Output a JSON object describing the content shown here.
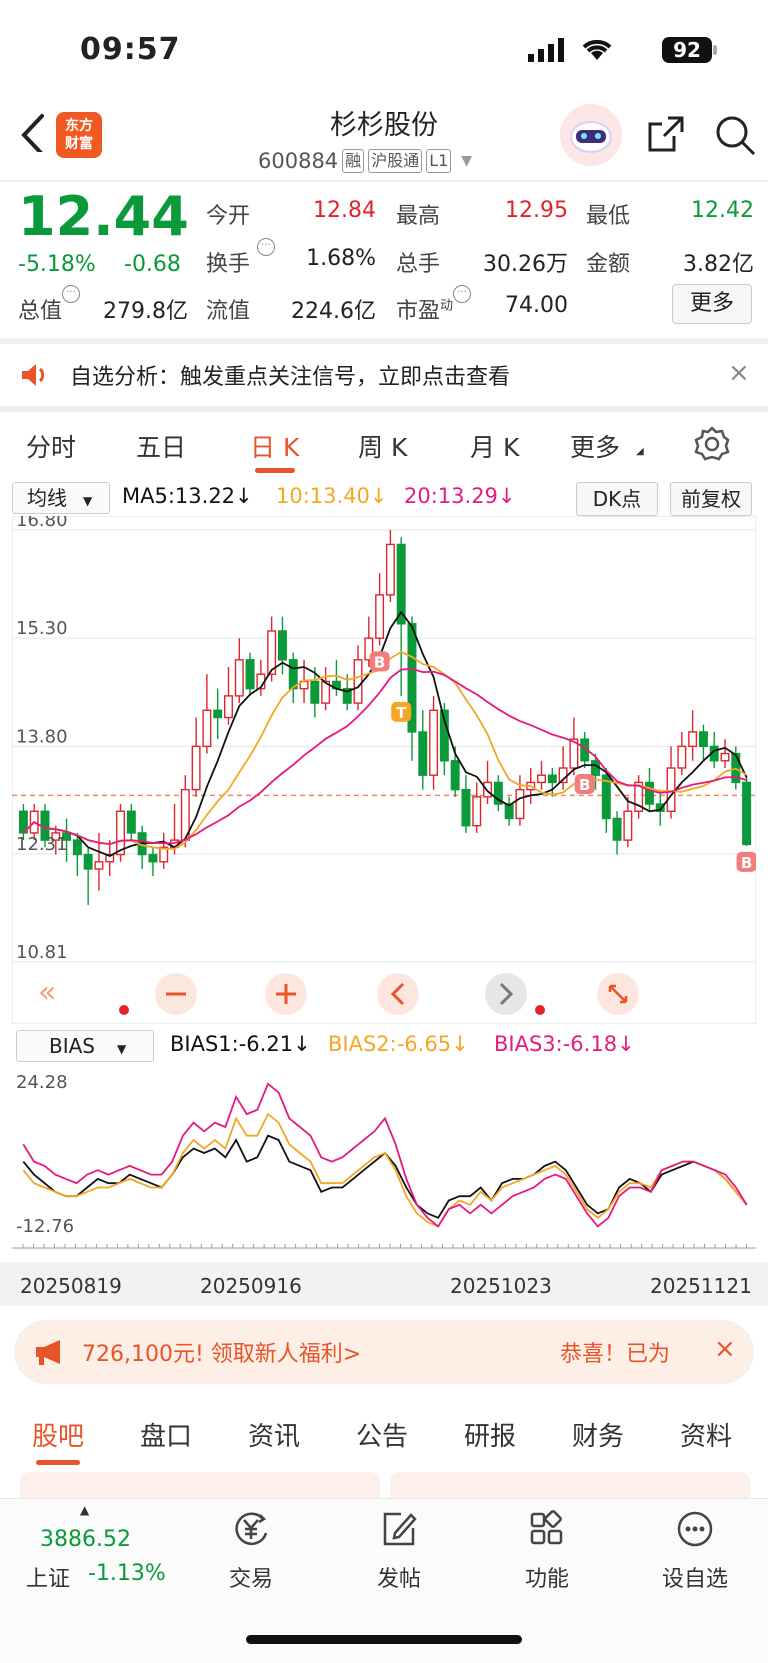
{
  "status_bar": {
    "time": "09:57",
    "battery": "92"
  },
  "header": {
    "logo_text_1": "东方",
    "logo_text_2": "财富",
    "stock_name": "杉杉股份",
    "stock_code": "600884",
    "tags": [
      "融",
      "沪股通",
      "L1"
    ]
  },
  "quote": {
    "price": "12.44",
    "change_pct": "-5.18%",
    "change": "-0.68",
    "open_label": "今开",
    "open": "12.84",
    "high_label": "最高",
    "high": "12.95",
    "low_label": "最低",
    "low": "12.42",
    "turnover_label": "换手",
    "turnover": "1.68%",
    "volume_label": "总手",
    "volume": "30.26万",
    "amount_label": "金额",
    "amount": "3.82亿",
    "mktcap_label": "总值",
    "mktcap": "279.8亿",
    "float_label": "流值",
    "float_cap": "224.6亿",
    "pe_label": "市盈",
    "pe_sup": "动",
    "pe": "74.00",
    "more_button": "更多"
  },
  "notice": {
    "text": "自选分析：触发重点关注信号，立即点击查看",
    "close": "×"
  },
  "period_tabs": [
    {
      "label": "分时"
    },
    {
      "label": "五日"
    },
    {
      "label": "日 K"
    },
    {
      "label": "周 K"
    },
    {
      "label": "月 K"
    },
    {
      "label": "更多"
    }
  ],
  "ma_row": {
    "select": "均线",
    "ma5": "MA5:13.22",
    "ma10": "10:13.40",
    "ma20": "20:13.29",
    "dk_button": "DK点",
    "fq_button": "前复权"
  },
  "colors": {
    "up": "#e0242c",
    "down": "#0a9a3a",
    "ma5": "#111111",
    "ma10": "#f5a623",
    "ma20": "#e5197f",
    "accent": "#e8542a"
  },
  "chart_data": [
    {
      "type": "candlestick",
      "title": "",
      "y_ticks": [
        "16.80",
        "15.30",
        "13.80",
        "12.31",
        "10.81"
      ],
      "ylim": [
        10.81,
        16.8
      ],
      "reference_price": 13.12,
      "markers": [
        "B",
        "T",
        "B",
        "B"
      ],
      "candles": [
        [
          12.9,
          12.6,
          13.0,
          12.5
        ],
        [
          12.6,
          12.9,
          13.0,
          12.5
        ],
        [
          12.9,
          12.5,
          13.0,
          12.4
        ],
        [
          12.5,
          12.6,
          12.7,
          12.3
        ],
        [
          12.6,
          12.5,
          12.8,
          12.2
        ],
        [
          12.5,
          12.3,
          12.6,
          12.0
        ],
        [
          12.3,
          12.1,
          12.4,
          11.6
        ],
        [
          12.1,
          12.2,
          12.6,
          11.8
        ],
        [
          12.2,
          12.3,
          12.5,
          12.0
        ],
        [
          12.3,
          12.9,
          13.0,
          12.2
        ],
        [
          12.9,
          12.6,
          13.0,
          12.5
        ],
        [
          12.6,
          12.3,
          12.7,
          12.1
        ],
        [
          12.3,
          12.2,
          12.4,
          12.0
        ],
        [
          12.2,
          12.4,
          12.6,
          12.1
        ],
        [
          12.4,
          12.5,
          13.0,
          12.3
        ],
        [
          12.5,
          13.2,
          13.4,
          12.4
        ],
        [
          13.2,
          13.8,
          14.2,
          13.1
        ],
        [
          13.8,
          14.3,
          14.8,
          13.7
        ],
        [
          14.3,
          14.2,
          14.6,
          13.9
        ],
        [
          14.2,
          14.5,
          14.9,
          14.1
        ],
        [
          14.5,
          15.0,
          15.3,
          14.4
        ],
        [
          15.0,
          14.6,
          15.1,
          14.5
        ],
        [
          14.6,
          14.8,
          15.0,
          14.5
        ],
        [
          14.8,
          15.4,
          15.6,
          14.7
        ],
        [
          15.4,
          15.0,
          15.6,
          14.8
        ],
        [
          15.0,
          14.6,
          15.1,
          14.4
        ],
        [
          14.6,
          14.7,
          15.0,
          14.4
        ],
        [
          14.7,
          14.4,
          14.9,
          14.2
        ],
        [
          14.4,
          14.7,
          14.9,
          14.3
        ],
        [
          14.7,
          14.6,
          15.0,
          14.5
        ],
        [
          14.6,
          14.4,
          14.8,
          14.3
        ],
        [
          14.4,
          15.0,
          15.2,
          14.3
        ],
        [
          15.0,
          15.3,
          15.6,
          14.9
        ],
        [
          15.3,
          15.9,
          16.2,
          15.2
        ],
        [
          15.9,
          16.6,
          16.8,
          15.8
        ],
        [
          16.6,
          15.5,
          16.7,
          14.5
        ],
        [
          15.5,
          14.0,
          15.6,
          13.6
        ],
        [
          14.0,
          13.4,
          14.3,
          13.2
        ],
        [
          13.4,
          14.3,
          14.5,
          13.2
        ],
        [
          14.3,
          13.6,
          14.4,
          13.4
        ],
        [
          13.6,
          13.2,
          13.8,
          13.1
        ],
        [
          13.2,
          12.7,
          13.4,
          12.6
        ],
        [
          12.7,
          13.1,
          13.3,
          12.6
        ],
        [
          13.1,
          13.3,
          13.6,
          13.0
        ],
        [
          13.3,
          13.0,
          13.4,
          12.9
        ],
        [
          13.0,
          12.8,
          13.1,
          12.7
        ],
        [
          12.8,
          13.2,
          13.4,
          12.7
        ],
        [
          13.2,
          13.3,
          13.5,
          13.0
        ],
        [
          13.3,
          13.4,
          13.6,
          13.2
        ],
        [
          13.4,
          13.3,
          13.5,
          13.1
        ],
        [
          13.3,
          13.5,
          13.8,
          13.2
        ],
        [
          13.5,
          13.9,
          14.2,
          13.4
        ],
        [
          13.9,
          13.6,
          14.0,
          13.5
        ],
        [
          13.6,
          13.4,
          13.7,
          13.2
        ],
        [
          13.4,
          12.8,
          13.5,
          12.6
        ],
        [
          12.8,
          12.5,
          12.9,
          12.3
        ],
        [
          12.5,
          12.9,
          13.1,
          12.4
        ],
        [
          12.9,
          13.3,
          13.4,
          12.8
        ],
        [
          13.3,
          13.0,
          13.5,
          12.9
        ],
        [
          13.0,
          12.9,
          13.2,
          12.7
        ],
        [
          12.9,
          13.5,
          13.8,
          12.8
        ],
        [
          13.5,
          13.8,
          14.0,
          13.4
        ],
        [
          13.8,
          14.0,
          14.3,
          13.6
        ],
        [
          14.0,
          13.8,
          14.1,
          13.6
        ],
        [
          13.8,
          13.6,
          14.0,
          13.5
        ],
        [
          13.6,
          13.7,
          13.9,
          13.5
        ],
        [
          13.7,
          13.3,
          13.8,
          13.2
        ],
        [
          13.3,
          12.44,
          13.4,
          12.42
        ]
      ]
    },
    {
      "type": "line",
      "title": "",
      "select": "BIAS",
      "labels": {
        "bias1": "BIAS1:-6.21",
        "bias2": "BIAS2:-6.65",
        "bias3": "BIAS3:-6.18"
      },
      "y_ticks": [
        "24.28",
        "-12.76"
      ],
      "ylim": [
        -12.76,
        24.28
      ],
      "x_ticks": [
        "20250819",
        "20250916",
        "20251023",
        "20251121"
      ],
      "series": [
        {
          "name": "BIAS1",
          "color": "#111111",
          "values": [
            4,
            1,
            -1,
            -3,
            -4,
            -4,
            -2,
            0,
            -1,
            -1,
            1,
            0,
            -1,
            -2,
            1,
            5,
            7,
            6,
            7,
            5,
            9,
            4,
            5,
            10,
            9,
            4,
            3,
            2,
            -3,
            -2,
            -2,
            0,
            2,
            4,
            6,
            3,
            -2,
            -6,
            -8,
            -9,
            -5,
            -4,
            -4,
            -2,
            -5,
            -1,
            0,
            0,
            1,
            3,
            4,
            2,
            -2,
            -6,
            -8,
            -7,
            -2,
            0,
            -1,
            -3,
            1,
            2,
            3,
            4,
            3,
            2,
            0,
            -3,
            -6
          ]
        },
        {
          "name": "BIAS2",
          "color": "#f5a623",
          "values": [
            2,
            -1,
            -2,
            -3,
            -4,
            -4,
            -3,
            -2,
            -2,
            -1,
            0,
            -1,
            -2,
            -2,
            1,
            6,
            9,
            7,
            9,
            7,
            14,
            10,
            10,
            15,
            13,
            8,
            6,
            4,
            -1,
            -1,
            -1,
            1,
            3,
            5,
            6,
            2,
            -4,
            -8,
            -10,
            -11,
            -7,
            -5,
            -6,
            -3,
            -5,
            -2,
            -1,
            0,
            1,
            2,
            3,
            1,
            -3,
            -7,
            -9,
            -7,
            -3,
            -1,
            -1,
            -2,
            2,
            3,
            4,
            4,
            3,
            2,
            0,
            -3,
            -6
          ]
        },
        {
          "name": "BIAS3",
          "color": "#e5197f",
          "values": [
            8,
            4,
            3,
            1,
            0,
            -1,
            1,
            2,
            1,
            2,
            3,
            2,
            1,
            1,
            4,
            10,
            13,
            11,
            13,
            12,
            19,
            15,
            16,
            22,
            20,
            14,
            12,
            10,
            5,
            4,
            5,
            7,
            9,
            11,
            14,
            8,
            0,
            -6,
            -9,
            -11,
            -7,
            -6,
            -8,
            -6,
            -8,
            -6,
            -4,
            -3,
            -2,
            0,
            1,
            0,
            -4,
            -8,
            -11,
            -9,
            -4,
            -2,
            -2,
            -3,
            2,
            3,
            4,
            4,
            3,
            2,
            1,
            -2,
            -6
          ]
        }
      ]
    }
  ],
  "promo": {
    "text": "726,100元! 领取新人福利>",
    "text2": "恭喜！已为",
    "close": "×"
  },
  "content_tabs": [
    {
      "label": "股吧"
    },
    {
      "label": "盘口"
    },
    {
      "label": "资讯"
    },
    {
      "label": "公告"
    },
    {
      "label": "研报"
    },
    {
      "label": "财务"
    },
    {
      "label": "资料"
    }
  ],
  "bottom_nav": {
    "index_value": "3886.52",
    "index_name": "上证",
    "index_pct": "-1.13%",
    "items": [
      {
        "label": "交易",
        "icon": "yen-exchange-icon"
      },
      {
        "label": "发帖",
        "icon": "edit-icon"
      },
      {
        "label": "功能",
        "icon": "grid-icon"
      },
      {
        "label": "设自选",
        "icon": "more-dots-icon"
      }
    ]
  }
}
